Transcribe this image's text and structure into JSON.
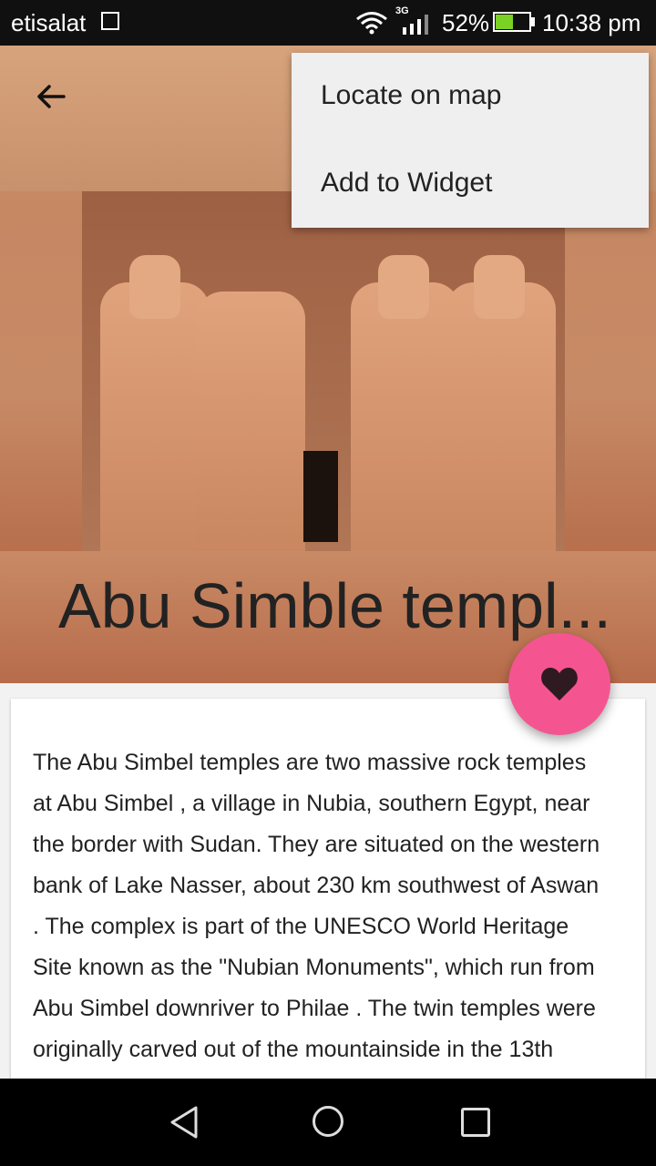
{
  "status_bar": {
    "carrier": "etisalat",
    "network": "3G",
    "battery_percent": "52%",
    "battery_level": 0.52,
    "time": "10:38 pm",
    "icons": [
      "image-icon",
      "wifi-icon",
      "signal-icon",
      "battery-charging-icon"
    ]
  },
  "header": {
    "back_icon": "arrow-left-icon",
    "title": "Abu Simble templ..."
  },
  "overflow_menu": {
    "items": [
      {
        "label": "Locate on map"
      },
      {
        "label": "Add to Widget"
      }
    ]
  },
  "fab": {
    "icon": "heart-icon",
    "color": "#f45591"
  },
  "description": {
    "lines": [
      "The Abu Simbel temples are two massive rock temples",
      "at Abu Simbel , a village in Nubia, southern Egypt, near",
      "the border with Sudan. They are situated on the western",
      "bank of Lake Nasser, about 230 km southwest of Aswan",
      ". The complex is part of the UNESCO World Heritage",
      "Site known as the \"Nubian Monuments\", which run from",
      "Abu Simbel downriver to Philae . The twin temples were",
      "originally carved out of the mountainside in the 13th"
    ]
  },
  "nav_bar": {
    "icons": [
      "nav-back-icon",
      "nav-home-icon",
      "nav-recents-icon"
    ]
  }
}
